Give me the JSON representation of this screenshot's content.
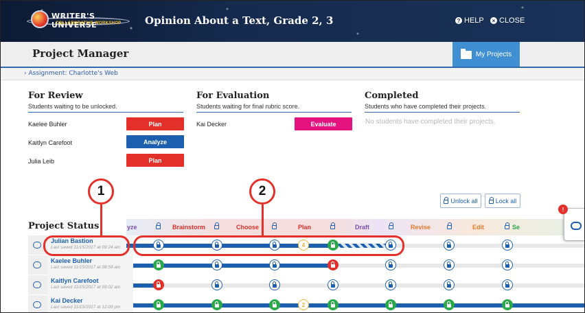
{
  "header": {
    "brand": "WRITER'S UNIVERSE",
    "brand_sub": "COLLABORATIVE WORKSHOP",
    "title": "Opinion About a Text, Grade 2, 3",
    "help_label": "HELP",
    "close_label": "CLOSE"
  },
  "manager": {
    "title": "Project Manager",
    "my_projects": "My Projects",
    "breadcrumb": "Assignment: Charlotte's Web"
  },
  "for_review": {
    "title": "For Review",
    "subtitle": "Students waiting to be unlocked.",
    "students": [
      {
        "name": "Kaelee Buhler",
        "action": "Plan"
      },
      {
        "name": "Kaitlyn Carefoot",
        "action": "Analyze"
      },
      {
        "name": "Julia Leib",
        "action": "Plan"
      }
    ]
  },
  "for_evaluation": {
    "title": "For Evaluation",
    "subtitle": "Students waiting for final rubric score.",
    "students": [
      {
        "name": "Kai Decker",
        "action": "Evaluate"
      }
    ]
  },
  "completed": {
    "title": "Completed",
    "subtitle": "Students who have completed their projects.",
    "empty": "No students have completed their projects."
  },
  "controls": {
    "unlock_all": "Unlock all",
    "lock_all": "Lock all"
  },
  "project_status": {
    "title": "Project Status",
    "stages": [
      "yze",
      "Brainstorm",
      "Choose",
      "Plan",
      "Draft",
      "Revise",
      "Edit",
      "Se"
    ],
    "stage_colors": [
      "#7a4fb0",
      "#d9302a",
      "#d9302a",
      "#d9302a",
      "#7a4fb0",
      "#e87a2a",
      "#e87a2a",
      "#2aa84a"
    ],
    "rows": [
      {
        "name": "Julian Bastion",
        "saved": "Last saved 11/15/2017 at 09:24 am"
      },
      {
        "name": "Kaelee Buhler",
        "saved": "Last saved 11/15/2017 at 08:59 am"
      },
      {
        "name": "Kaitlyn Carefoot",
        "saved": "Last saved 11/15/2017 at 09:02 am"
      },
      {
        "name": "Kai Decker",
        "saved": "Last saved 11/15/2017 at 12:09 pm"
      }
    ],
    "node_4": "4",
    "node_2": "2"
  },
  "callouts": {
    "one": "1",
    "two": "2"
  },
  "notification_count": "!"
}
